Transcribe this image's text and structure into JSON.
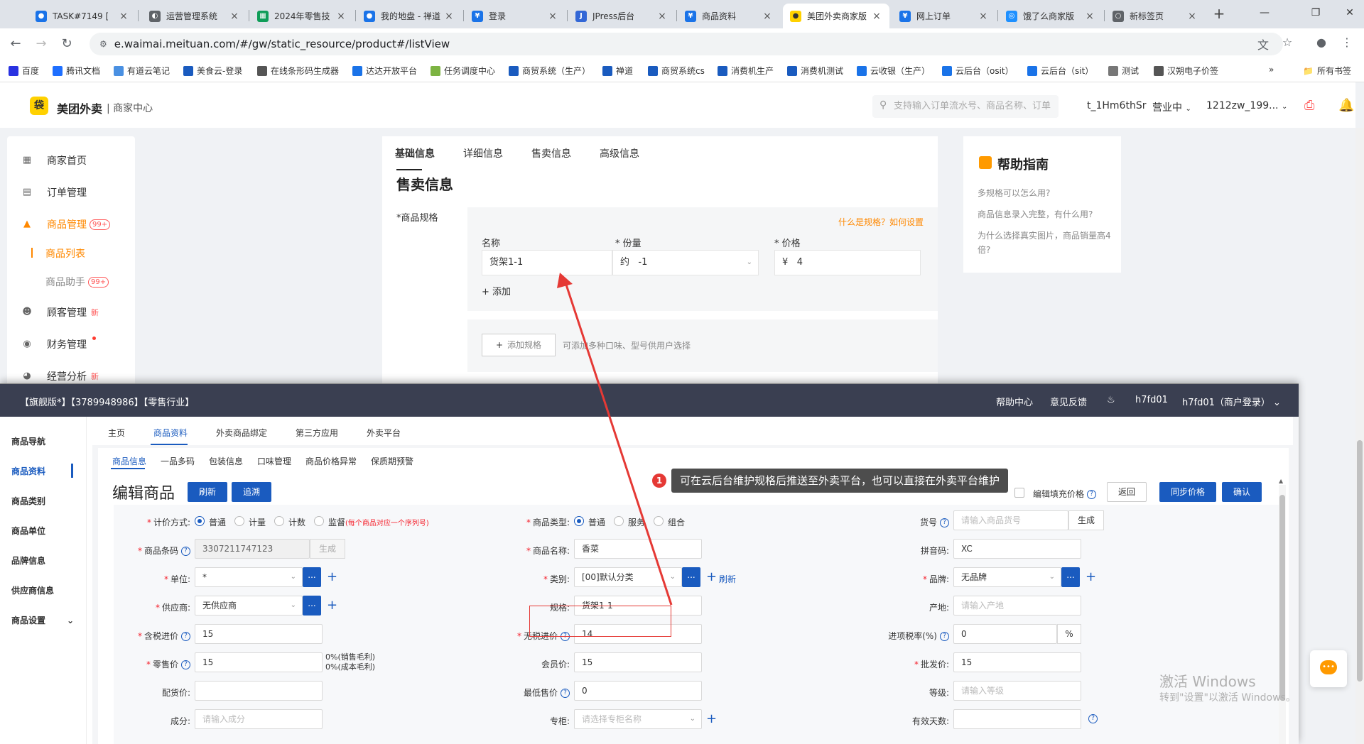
{
  "browser": {
    "tabs": [
      {
        "title": "TASK#7149 [",
        "color": "#1a73e8",
        "glyph": "●"
      },
      {
        "title": "运营管理系统",
        "color": "#5f6368",
        "glyph": "◐"
      },
      {
        "title": "2024年零售技",
        "color": "#0f9d58",
        "glyph": "▦"
      },
      {
        "title": "我的地盘 - 禅道",
        "color": "#1a73e8",
        "glyph": "●"
      },
      {
        "title": "登录",
        "color": "#1a73e8",
        "glyph": "¥"
      },
      {
        "title": "JPress后台",
        "color": "#3367d6",
        "glyph": "J"
      },
      {
        "title": "商品资料",
        "color": "#1a73e8",
        "glyph": "¥"
      },
      {
        "title": "美团外卖商家版",
        "color": "#ffd100",
        "glyph": "●"
      },
      {
        "title": "网上订单",
        "color": "#1a73e8",
        "glyph": "¥"
      },
      {
        "title": "饿了么商家版",
        "color": "#1e90ff",
        "glyph": "◎"
      },
      {
        "title": "新标签页",
        "color": "#5f6368",
        "glyph": "○"
      }
    ],
    "close_glyph": "×",
    "new_tab": "+",
    "url": "e.waimai.meituan.com/#/gw/static_resource/product#/listView",
    "bookmarks": [
      {
        "label": "百度",
        "color": "#2932e1"
      },
      {
        "label": "腾讯文档",
        "color": "#1e6fff"
      },
      {
        "label": "有道云笔记",
        "color": "#4a90e2"
      },
      {
        "label": "美食云-登录",
        "color": "#1a5bbf"
      },
      {
        "label": "在线条形码生成器",
        "color": "#555555"
      },
      {
        "label": "达达开放平台",
        "color": "#1a73e8"
      },
      {
        "label": "任务调度中心",
        "color": "#7cb342"
      },
      {
        "label": "商贸系统（生产）",
        "color": "#1a5bbf"
      },
      {
        "label": "禅道",
        "color": "#1a5bbf"
      },
      {
        "label": "商贸系统cs",
        "color": "#1a5bbf"
      },
      {
        "label": "消费机生产",
        "color": "#1a5bbf"
      },
      {
        "label": "消费机测试",
        "color": "#1a5bbf"
      },
      {
        "label": "云收银（生产）",
        "color": "#1a73e8"
      },
      {
        "label": "云后台（osit）",
        "color": "#1a73e8"
      },
      {
        "label": "云后台（sit）",
        "color": "#1a73e8"
      },
      {
        "label": "测试",
        "color": "#777777"
      },
      {
        "label": "汉朔电子价签",
        "color": "#555555"
      }
    ],
    "all_bookmarks": "所有书签",
    "more": "»"
  },
  "meituan": {
    "brand": "美团外卖",
    "sub": "| 商家中心",
    "search_placeholder": "支持输入订单流水号、商品名称、订单",
    "user": "t_1Hm6thSr",
    "status": "营业中",
    "shop": "1212zw_199...",
    "sidebar": {
      "items": [
        {
          "label": "商家首页"
        },
        {
          "label": "订单管理"
        },
        {
          "label": "商品管理",
          "badge": "99+"
        },
        {
          "label": "商品列表"
        },
        {
          "label": "商品助手",
          "badge": "99+"
        },
        {
          "label": "顾客管理",
          "badge": "新"
        },
        {
          "label": "财务管理"
        },
        {
          "label": "经营分析",
          "badge": "新"
        }
      ]
    },
    "tabs": [
      "基础信息",
      "详细信息",
      "售卖信息",
      "高级信息"
    ],
    "section_title": "售卖信息",
    "spec_label": "*商品规格",
    "spec_hint": "什么是规格？如何设置",
    "col_name": "名称",
    "col_qty": "* 份量",
    "col_price": "* 价格",
    "name_value": "货架1-1",
    "qty_prefix": "约",
    "qty_value": "-1",
    "price_prefix": "¥",
    "price_value": "4",
    "add": "+ 添加",
    "add_spec": "添加规格",
    "add_spec_desc": "可添加多种口味、型号供用户选择",
    "help": {
      "title": "帮助指南",
      "links": [
        "多规格可以怎么用?",
        "商品信息录入完整，有什么用?",
        "为什么选择真实图片，商品销量高4倍?"
      ]
    }
  },
  "cloud": {
    "title": "【旗舰版*】【3789948986】【零售行业】",
    "top_items": [
      "帮助中心",
      "意见反馈",
      "h7fd01",
      "h7fd01（商户登录）"
    ],
    "sidebar": [
      "商品导航",
      "商品资料",
      "商品类别",
      "商品单位",
      "品牌信息",
      "供应商信息",
      "商品设置"
    ],
    "nav1": [
      "主页",
      "商品资料",
      "外卖商品绑定",
      "第三方应用",
      "外卖平台"
    ],
    "nav2": [
      "商品信息",
      "一品多码",
      "包装信息",
      "口味管理",
      "商品价格异常",
      "保质期预警"
    ],
    "heading": "编辑商品",
    "btn_refresh": "刷新",
    "btn_trace": "追溯",
    "edit_fill_price": "编辑填充价格",
    "btn_back": "返回",
    "btn_sync": "同步价格",
    "btn_confirm": "确认",
    "form": {
      "pricing_mode": "计价方式:",
      "pricing_opts": [
        "普通",
        "计量",
        "计数",
        "监督"
      ],
      "pricing_note": "(每个商品对应一个序列号)",
      "product_type": "商品类型:",
      "type_opts": [
        "普通",
        "服务",
        "组合"
      ],
      "sku": "货号",
      "sku_ph": "请输入商品货号",
      "gen": "生成",
      "barcode": "商品条码",
      "barcode_val": "3307211747123",
      "name": "商品名称:",
      "name_val": "香菜",
      "pinyin": "拼音码:",
      "pinyin_val": "XC",
      "unit": "单位:",
      "unit_val": "*",
      "category": "类别:",
      "category_val": "[00]默认分类",
      "refresh": "刷新",
      "brand": "品牌:",
      "brand_val": "无品牌",
      "supplier": "供应商:",
      "supplier_val": "无供应商",
      "spec": "规格:",
      "spec_val": "货架1-1",
      "origin": "产地:",
      "origin_ph": "请输入产地",
      "tax_cost": "含税进价",
      "tax_cost_val": "15",
      "notax_cost": "无税进价",
      "notax_cost_val": "14",
      "tax_rate": "进项税率(%)",
      "tax_rate_val": "0",
      "pct": "%",
      "retail": "零售价",
      "retail_val": "15",
      "margin1": "0%(销售毛利)",
      "margin2": "0%(成本毛利)",
      "member": "会员价:",
      "member_val": "15",
      "wholesale": "批发价:",
      "wholesale_val": "15",
      "dist": "配货价:",
      "min_price": "最低售价",
      "min_price_val": "0",
      "grade": "等级:",
      "grade_ph": "请输入等级",
      "ingredient": "成分:",
      "ingredient_ph": "请输入成分",
      "counter": "专柜:",
      "counter_ph": "请选择专柜名称",
      "shelf_life": "有效天数:"
    }
  },
  "annotation": {
    "num": "1",
    "text": "可在云后台维护规格后推送至外卖平台，也可以直接在外卖平台维护",
    "color": "#e53935"
  },
  "windows": {
    "line1": "激活 Windows",
    "line2": "转到\"设置\"以激活 Windows。"
  }
}
